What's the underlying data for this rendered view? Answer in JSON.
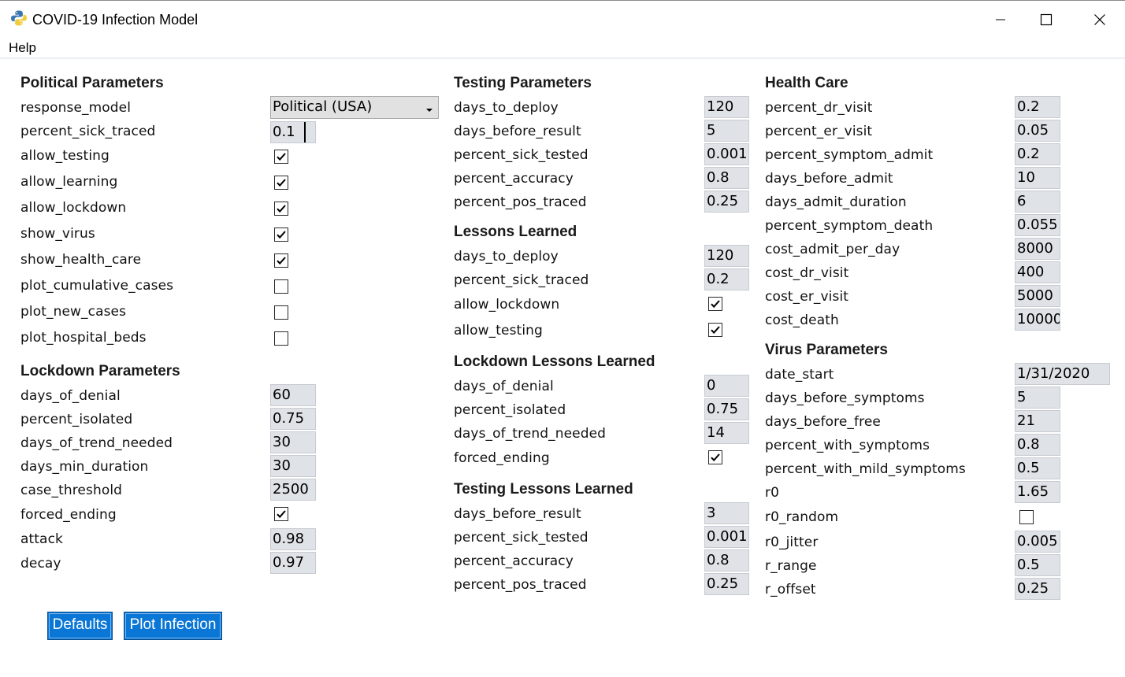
{
  "window": {
    "title": "COVID-19 Infection Model",
    "controls": {
      "minimize": "minimize-icon",
      "maximize": "maximize-icon",
      "close": "close-icon"
    }
  },
  "menu": {
    "help": "Help"
  },
  "sections": {
    "political": "Political Parameters",
    "lockdown": "Lockdown Parameters",
    "testing": "Testing Parameters",
    "lessons": "Lessons Learned",
    "lockdown_lessons": "Lockdown Lessons Learned",
    "testing_lessons": "Testing Lessons Learned",
    "health_care": "Health Care",
    "virus": "Virus Parameters"
  },
  "political": {
    "response_model": {
      "label": "response_model",
      "value": "Political (USA)"
    },
    "percent_sick_traced": {
      "label": "percent_sick_traced",
      "value": "0.1"
    },
    "allow_testing": {
      "label": "allow_testing",
      "checked": true
    },
    "allow_learning": {
      "label": "allow_learning",
      "checked": true
    },
    "allow_lockdown": {
      "label": "allow_lockdown",
      "checked": true
    },
    "show_virus": {
      "label": "show_virus",
      "checked": true
    },
    "show_health_care": {
      "label": "show_health_care",
      "checked": true
    },
    "plot_cumulative_cases": {
      "label": "plot_cumulative_cases",
      "checked": false
    },
    "plot_new_cases": {
      "label": "plot_new_cases",
      "checked": false
    },
    "plot_hospital_beds": {
      "label": "plot_hospital_beds",
      "checked": false
    }
  },
  "lockdown": {
    "days_of_denial": {
      "label": "days_of_denial",
      "value": "60"
    },
    "percent_isolated": {
      "label": "percent_isolated",
      "value": "0.75"
    },
    "days_of_trend_needed": {
      "label": "days_of_trend_needed",
      "value": "30"
    },
    "days_min_duration": {
      "label": "days_min_duration",
      "value": "30"
    },
    "case_threshold": {
      "label": "case_threshold",
      "value": "2500"
    },
    "forced_ending": {
      "label": "forced_ending",
      "checked": true
    },
    "attack": {
      "label": "attack",
      "value": "0.98"
    },
    "decay": {
      "label": "decay",
      "value": "0.97"
    }
  },
  "testing": {
    "days_to_deploy": {
      "label": "days_to_deploy",
      "value": "120"
    },
    "days_before_result": {
      "label": "days_before_result",
      "value": "5"
    },
    "percent_sick_tested": {
      "label": "percent_sick_tested",
      "value": "0.001"
    },
    "percent_accuracy": {
      "label": "percent_accuracy",
      "value": "0.8"
    },
    "percent_pos_traced": {
      "label": "percent_pos_traced",
      "value": "0.25"
    }
  },
  "lessons": {
    "days_to_deploy": {
      "label": "days_to_deploy",
      "value": "120"
    },
    "percent_sick_traced": {
      "label": "percent_sick_traced",
      "value": "0.2"
    },
    "allow_lockdown": {
      "label": "allow_lockdown",
      "checked": true
    },
    "allow_testing": {
      "label": "allow_testing",
      "checked": true
    }
  },
  "lockdown_lessons": {
    "days_of_denial": {
      "label": "days_of_denial",
      "value": "0"
    },
    "percent_isolated": {
      "label": "percent_isolated",
      "value": "0.75"
    },
    "days_of_trend_needed": {
      "label": "days_of_trend_needed",
      "value": "14"
    },
    "forced_ending": {
      "label": "forced_ending",
      "checked": true
    }
  },
  "testing_lessons": {
    "days_before_result": {
      "label": "days_before_result",
      "value": "3"
    },
    "percent_sick_tested": {
      "label": "percent_sick_tested",
      "value": "0.001"
    },
    "percent_accuracy": {
      "label": "percent_accuracy",
      "value": "0.8"
    },
    "percent_pos_traced": {
      "label": "percent_pos_traced",
      "value": "0.25"
    }
  },
  "health_care": {
    "percent_dr_visit": {
      "label": "percent_dr_visit",
      "value": "0.2"
    },
    "percent_er_visit": {
      "label": "percent_er_visit",
      "value": "0.05"
    },
    "percent_symptom_admit": {
      "label": "percent_symptom_admit",
      "value": "0.2"
    },
    "days_before_admit": {
      "label": "days_before_admit",
      "value": "10"
    },
    "days_admit_duration": {
      "label": "days_admit_duration",
      "value": "6"
    },
    "percent_symptom_death": {
      "label": "percent_symptom_death",
      "value": "0.055"
    },
    "cost_admit_per_day": {
      "label": "cost_admit_per_day",
      "value": "8000"
    },
    "cost_dr_visit": {
      "label": "cost_dr_visit",
      "value": "400"
    },
    "cost_er_visit": {
      "label": "cost_er_visit",
      "value": "5000"
    },
    "cost_death": {
      "label": "cost_death",
      "value": "10000"
    }
  },
  "virus": {
    "date_start": {
      "label": "date_start",
      "value": "1/31/2020"
    },
    "days_before_symptoms": {
      "label": "days_before_symptoms",
      "value": "5"
    },
    "days_before_free": {
      "label": "days_before_free",
      "value": "21"
    },
    "percent_with_symptoms": {
      "label": "percent_with_symptoms",
      "value": "0.8"
    },
    "percent_with_mild_symptoms": {
      "label": "percent_with_mild_symptoms",
      "value": "0.5"
    },
    "r0": {
      "label": "r0",
      "value": "1.65"
    },
    "r0_random": {
      "label": "r0_random",
      "checked": false
    },
    "r0_jitter": {
      "label": "r0_jitter",
      "value": "0.005"
    },
    "r_range": {
      "label": "r_range",
      "value": "0.5"
    },
    "r_offset": {
      "label": "r_offset",
      "value": "0.25"
    }
  },
  "buttons": {
    "defaults": "Defaults",
    "plot": "Plot Infection"
  },
  "colors": {
    "field_bg": "#dfe2e6",
    "button_bg": "#0a76d6",
    "text": "#111111"
  }
}
